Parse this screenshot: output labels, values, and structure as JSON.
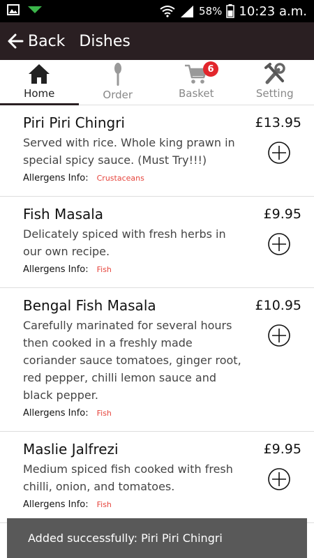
{
  "status_bar": {
    "signal_percent": "58%",
    "time": "10:23 a.m."
  },
  "app_bar": {
    "back_label": "Back",
    "title": "Dishes"
  },
  "tabs": [
    {
      "label": "Home",
      "icon": "home-icon",
      "active": true
    },
    {
      "label": "Order",
      "icon": "spoon-icon",
      "active": false
    },
    {
      "label": "Basket",
      "icon": "cart-icon",
      "active": false,
      "badge": "6"
    },
    {
      "label": "Setting",
      "icon": "tools-icon",
      "active": false
    }
  ],
  "dishes": [
    {
      "name": "Piri Piri Chingri",
      "price": "£13.95",
      "description": "Served with rice. Whole king prawn in special spicy sauce. (Must Try!!!)",
      "allergens_label": "Allergens Info:",
      "allergens": "Crustaceans"
    },
    {
      "name": "Fish Masala",
      "price": "£9.95",
      "description": "Delicately spiced with fresh herbs in our own recipe.",
      "allergens_label": "Allergens Info:",
      "allergens": "Fish"
    },
    {
      "name": "Bengal Fish Masala",
      "price": "£10.95",
      "description": "Carefully marinated for several hours then cooked in a freshly made coriander sauce tomatoes, ginger root, red pepper, chilli lemon sauce and black pepper.",
      "allergens_label": "Allergens Info:",
      "allergens": "Fish"
    },
    {
      "name": "Maslie Jalfrezi",
      "price": "£9.95",
      "description": "Medium spiced fish cooked with fresh chilli, onion, and tomatoes.",
      "allergens_label": "Allergens Info:",
      "allergens": "Fish"
    }
  ],
  "toast": {
    "message": "Added successfully: Piri Piri Chingri"
  },
  "colors": {
    "app_bar": "#2a1f22",
    "badge": "#e2262c",
    "allergen_text": "#e6443c",
    "toast_bg": "#595959"
  }
}
